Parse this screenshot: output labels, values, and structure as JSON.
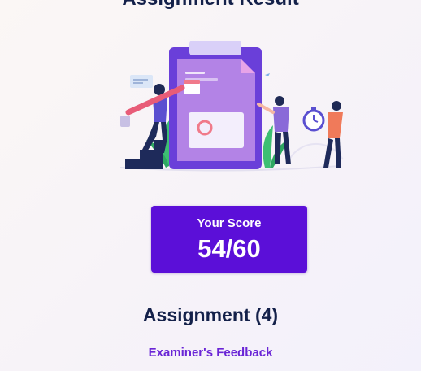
{
  "page": {
    "heading": "Assignment Result"
  },
  "hero": {
    "illustration": "assignment-review-illustration"
  },
  "score": {
    "label": "Your Score",
    "value": "54/60"
  },
  "assignment": {
    "title": "Assignment (4)"
  },
  "feedback": {
    "link_label": "Examiner's Feedback"
  },
  "colors": {
    "accent": "#5b0fd8",
    "heading": "#14214a",
    "link": "#6a25d6"
  }
}
